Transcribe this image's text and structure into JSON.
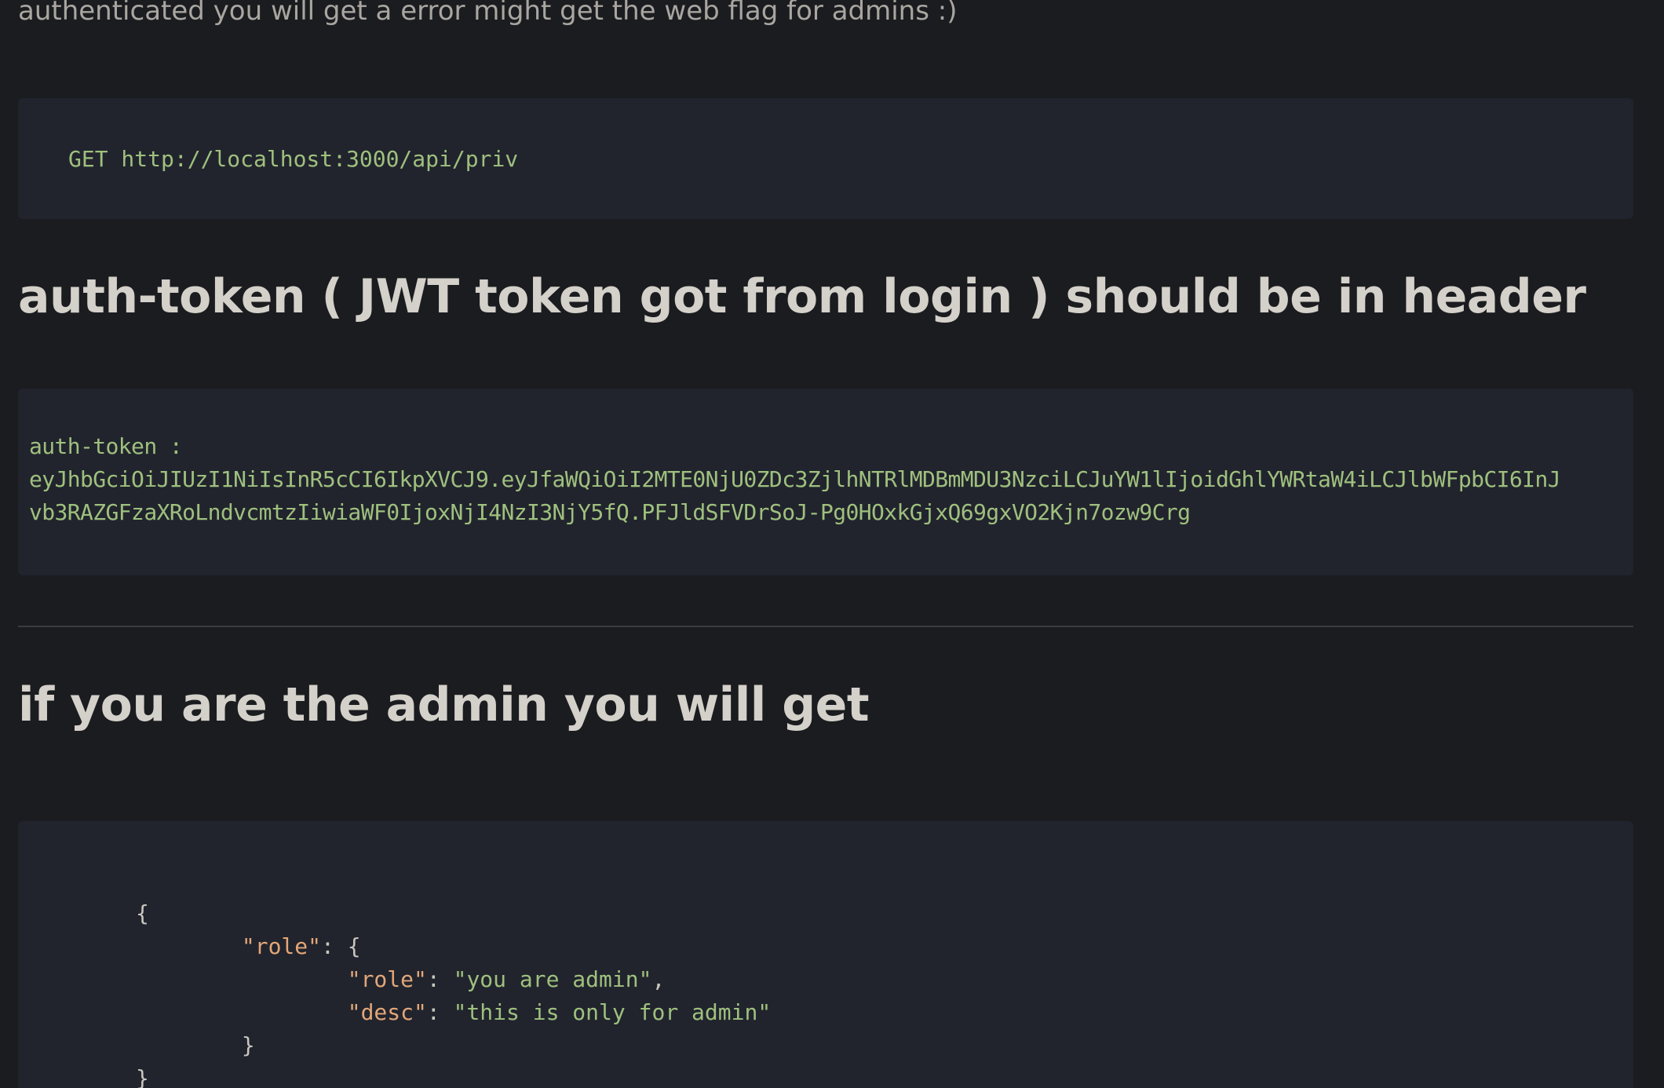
{
  "intro_text": "authenticated you will get a error might get the web flag for admins :)",
  "request": {
    "method_url": "GET http://localhost:3000/api/priv"
  },
  "auth_heading": "auth-token ( JWT token got from login ) should be in header",
  "token_block": {
    "label": "auth-token :",
    "line1": "eyJhbGciOiJIUzI1NiIsInR5cCI6IkpXVCJ9.eyJfaWQiOiI2MTE0NjU0ZDc3ZjlhNTRlMDBmMDU3NzciLCJuYW1lIjoidGhlYWRtaW4iLCJlbWFpbCI6InJ",
    "line2": "vb3RAZGFzaXRoLndvcmtzIiwiaWF0IjoxNjI4NzI3NjY5fQ.PFJldSFVDrSoJ-Pg0HOxkGjxQ69gxVO2Kjn7ozw9Crg"
  },
  "admin_heading": "if you are the admin you will get",
  "response": {
    "open_brace": "{",
    "role_key": "\"role\"",
    "colon_open": ": {",
    "inner_role_key": "\"role\"",
    "inner_role_value": "\"you are admin\"",
    "inner_desc_key": "\"desc\"",
    "inner_desc_value": "\"this is only for admin\"",
    "close_inner": "}",
    "close_outer": "}"
  },
  "colors": {
    "background": "#1b1c1f",
    "code_background": "#21242d",
    "code_green": "#9fc07e",
    "json_key_orange": "#e3a678"
  }
}
